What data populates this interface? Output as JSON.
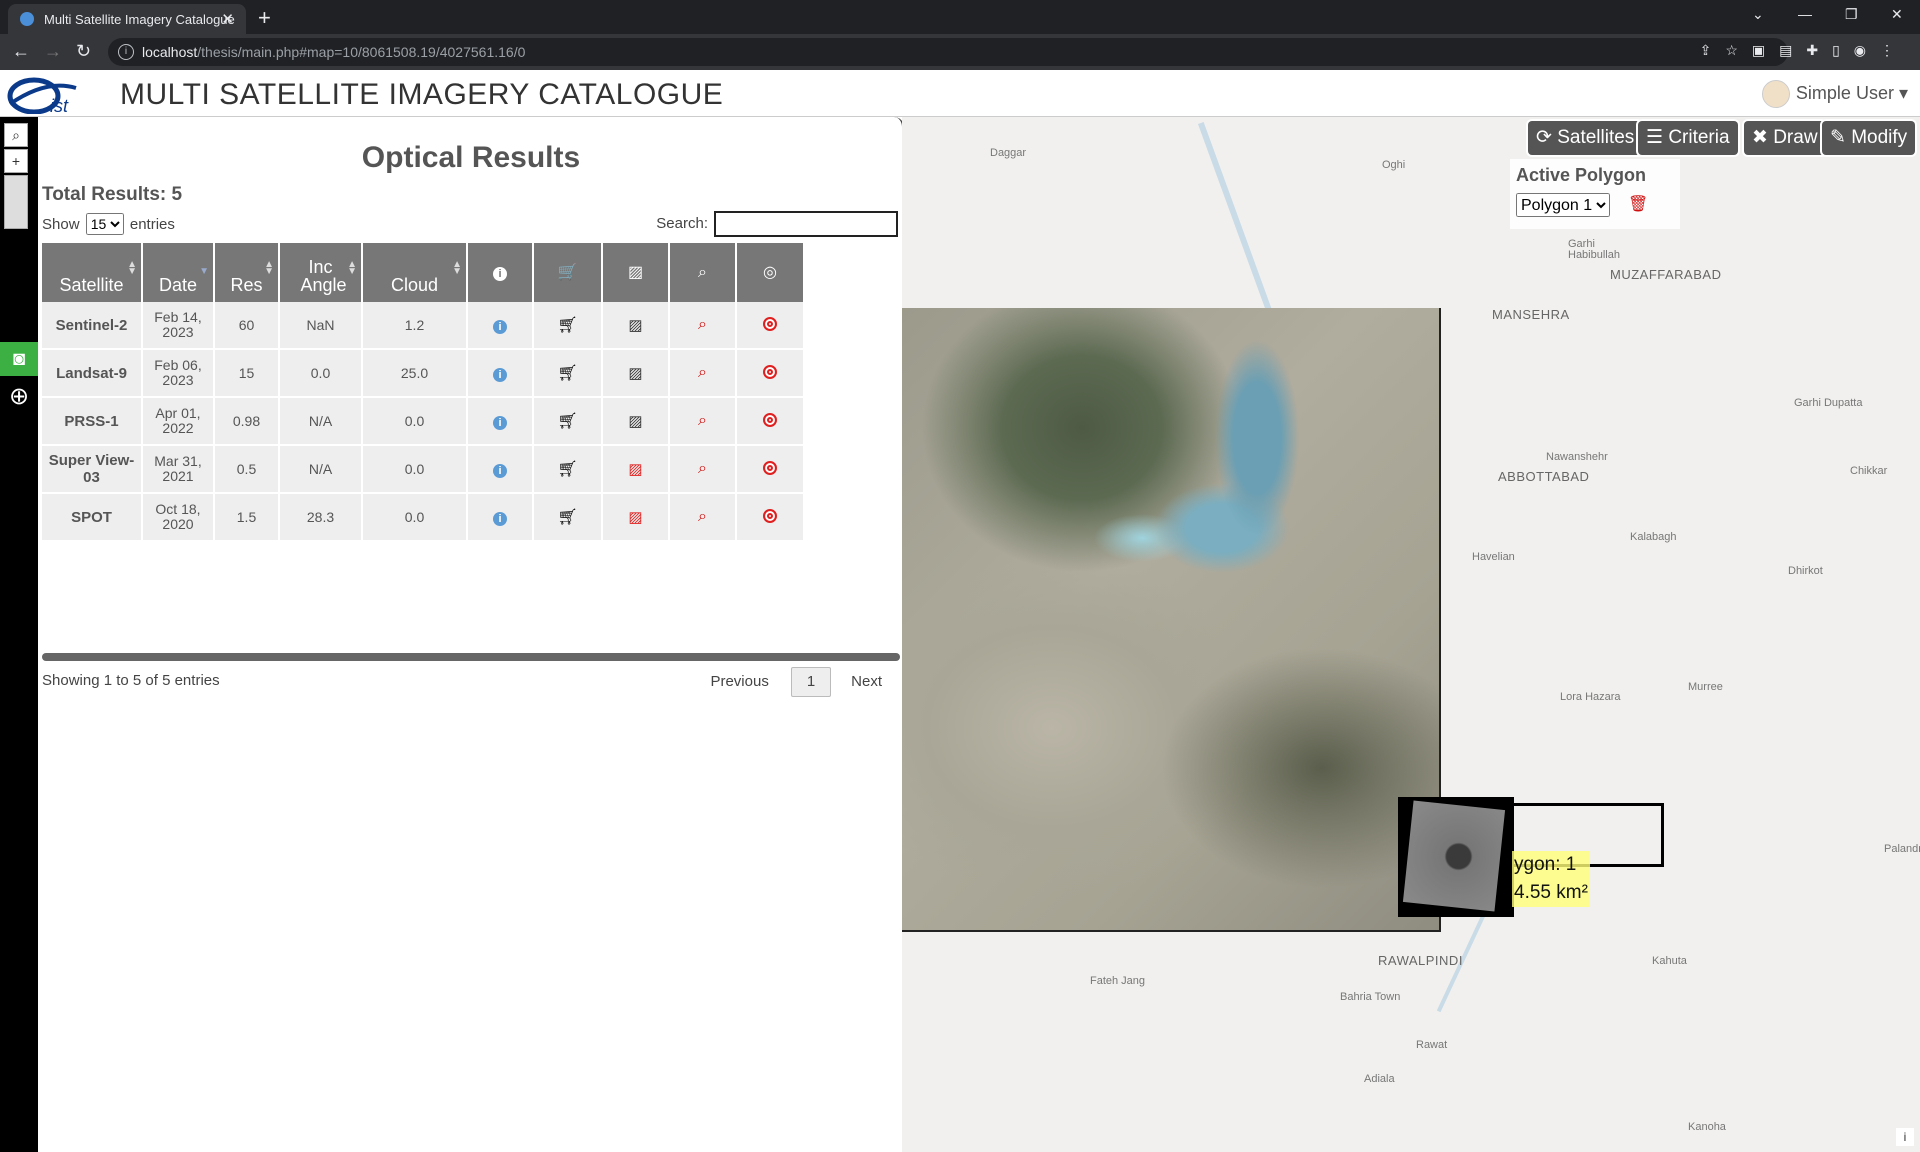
{
  "browser": {
    "tab_title": "Multi Satellite Imagery Catalogue",
    "url_host": "localhost",
    "url_path": "/thesis/main.php#map=10/8061508.19/4027561.16/0"
  },
  "app": {
    "title": "MULTI SATELLITE IMAGERY CATALOGUE",
    "user_label": "Simple User"
  },
  "results": {
    "title": "Optical Results",
    "total_label": "Total Results: 5",
    "show_label": "Show",
    "show_value": "15",
    "entries_label": "entries",
    "search_label": "Search:",
    "columns": {
      "satellite": "Satellite",
      "date": "Date",
      "res": "Res",
      "inc_angle": "Inc Angle",
      "cloud": "Cloud"
    },
    "rows": [
      {
        "satellite": "Sentinel-2",
        "date": "Feb 14, 2023",
        "res": "60",
        "inc": "NaN",
        "cloud": "1.2",
        "preview_color": "gray"
      },
      {
        "satellite": "Landsat-9",
        "date": "Feb 06, 2023",
        "res": "15",
        "inc": "0.0",
        "cloud": "25.0",
        "preview_color": "gray"
      },
      {
        "satellite": "PRSS-1",
        "date": "Apr 01, 2022",
        "res": "0.98",
        "inc": "N/A",
        "cloud": "0.0",
        "preview_color": "gray"
      },
      {
        "satellite": "Super View-03",
        "date": "Mar 31, 2021",
        "res": "0.5",
        "inc": "N/A",
        "cloud": "0.0",
        "preview_color": "red"
      },
      {
        "satellite": "SPOT",
        "date": "Oct 18, 2020",
        "res": "1.5",
        "inc": "28.3",
        "cloud": "0.0",
        "preview_color": "red"
      }
    ],
    "showing_label": "Showing 1 to 5 of 5 entries",
    "prev_label": "Previous",
    "page_label": "1",
    "next_label": "Next"
  },
  "map": {
    "buttons": {
      "satellites": "Satellites",
      "criteria": "Criteria",
      "draw": "Draw",
      "modify": "Modify"
    },
    "active_polygon_title": "Active Polygon",
    "active_polygon_value": "Polygon 1",
    "polygon_label_line1": "ygon: 1",
    "polygon_label_line2": "4.55 km²",
    "labels": [
      "Daggar",
      "Oghi",
      "Garhi Habibullah",
      "MUZAFFARABAD",
      "MANSEHRA",
      "Garhi Dupatta",
      "Nawanshehr",
      "ABBOTTABAD",
      "Chikkar",
      "Kalabagh",
      "Havelian",
      "Dhirkot",
      "Lora Hazara",
      "Murree",
      "Palandri",
      "RAWALPINDI",
      "Kahuta",
      "Fateh Jang",
      "Bahria Town",
      "Rawat",
      "Adiala",
      "Kanoha"
    ],
    "attribution": "i"
  },
  "colors": {
    "accent": "#555555",
    "camera_active": "#3cb043",
    "danger": "#e02020"
  }
}
